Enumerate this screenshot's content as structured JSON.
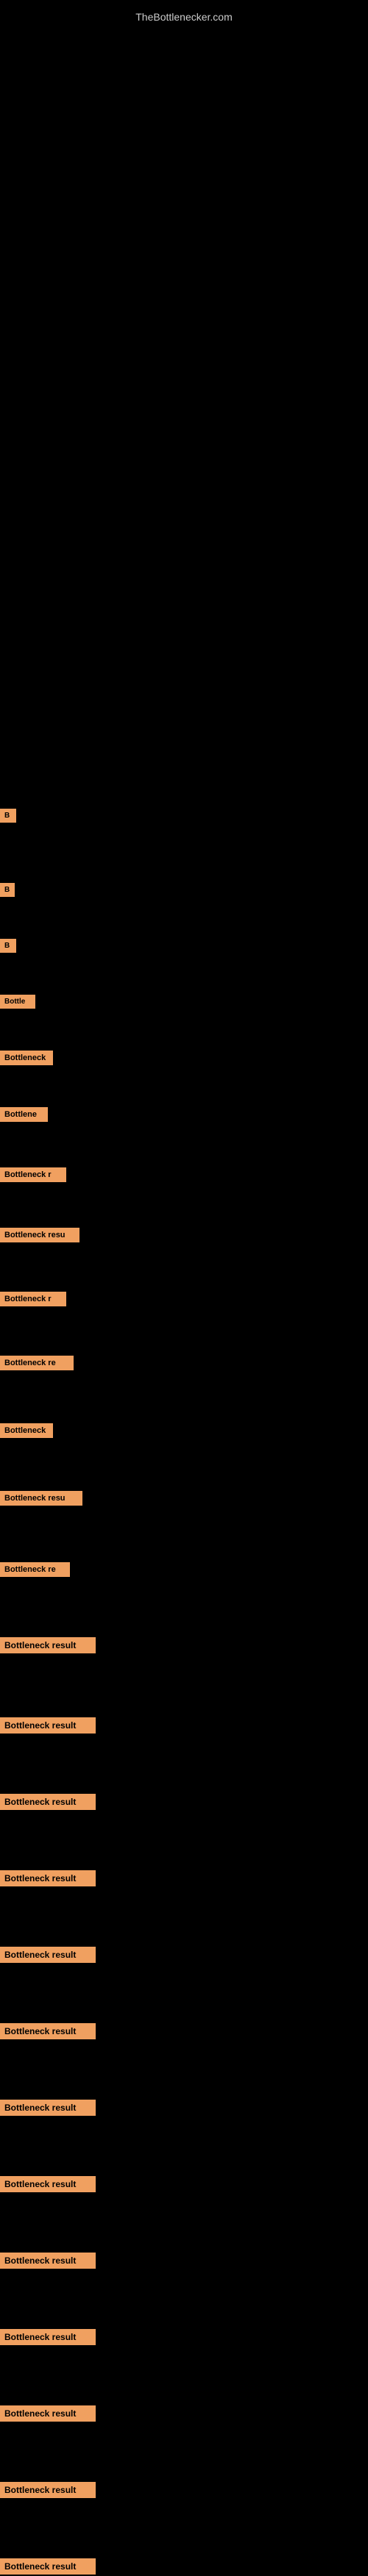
{
  "site": {
    "title": "TheBottlenecker.com"
  },
  "items": [
    {
      "id": 1,
      "label": "B",
      "class": "item-1"
    },
    {
      "id": 2,
      "label": "B",
      "class": "item-2"
    },
    {
      "id": 3,
      "label": "B",
      "class": "item-3"
    },
    {
      "id": 4,
      "label": "Bottle",
      "class": "item-4"
    },
    {
      "id": 5,
      "label": "Bottleneck",
      "class": "item-5"
    },
    {
      "id": 6,
      "label": "Bottlene",
      "class": "item-6"
    },
    {
      "id": 7,
      "label": "Bottleneck r",
      "class": "item-7"
    },
    {
      "id": 8,
      "label": "Bottleneck resu",
      "class": "item-8"
    },
    {
      "id": 9,
      "label": "Bottleneck r",
      "class": "item-9"
    },
    {
      "id": 10,
      "label": "Bottleneck re",
      "class": "item-10"
    },
    {
      "id": 11,
      "label": "Bottleneck",
      "class": "item-11"
    },
    {
      "id": 12,
      "label": "Bottleneck resu",
      "class": "item-12"
    },
    {
      "id": 13,
      "label": "Bottleneck re",
      "class": "item-13"
    },
    {
      "id": 14,
      "label": "Bottleneck result",
      "class": "item-14"
    },
    {
      "id": 15,
      "label": "Bottleneck result",
      "class": "item-15"
    },
    {
      "id": 16,
      "label": "Bottleneck result",
      "class": "item-16"
    },
    {
      "id": 17,
      "label": "Bottleneck result",
      "class": "item-17"
    },
    {
      "id": 18,
      "label": "Bottleneck result",
      "class": "item-18"
    },
    {
      "id": 19,
      "label": "Bottleneck result",
      "class": "item-19"
    },
    {
      "id": 20,
      "label": "Bottleneck result",
      "class": "item-20"
    },
    {
      "id": 21,
      "label": "Bottleneck result",
      "class": "item-21"
    },
    {
      "id": 22,
      "label": "Bottleneck result",
      "class": "item-22"
    },
    {
      "id": 23,
      "label": "Bottleneck result",
      "class": "item-23"
    },
    {
      "id": 24,
      "label": "Bottleneck result",
      "class": "item-24"
    },
    {
      "id": 25,
      "label": "Bottleneck result",
      "class": "item-25"
    },
    {
      "id": 26,
      "label": "Bottleneck result",
      "class": "item-26"
    }
  ]
}
